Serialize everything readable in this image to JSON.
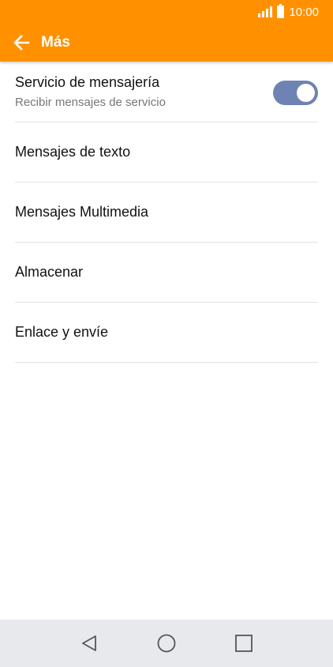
{
  "status_bar": {
    "time": "10:00",
    "signal_icon": "signal-icon",
    "battery_icon": "battery-icon"
  },
  "app_bar": {
    "back_icon": "arrow-left-icon",
    "title": "Más",
    "background": "#ff9100"
  },
  "settings": {
    "service_messaging": {
      "title": "Servicio de mensajería",
      "subtitle": "Recibir mensajes de servicio",
      "enabled": true,
      "toggle_color": "#6f82b4"
    },
    "items": [
      {
        "label": "Mensajes de texto"
      },
      {
        "label": "Mensajes Multimedia"
      },
      {
        "label": "Almacenar"
      },
      {
        "label": "Enlace y envíe"
      }
    ]
  },
  "nav_bar": {
    "back_icon": "triangle-back-icon",
    "home_icon": "circle-home-icon",
    "recents_icon": "square-recents-icon"
  }
}
